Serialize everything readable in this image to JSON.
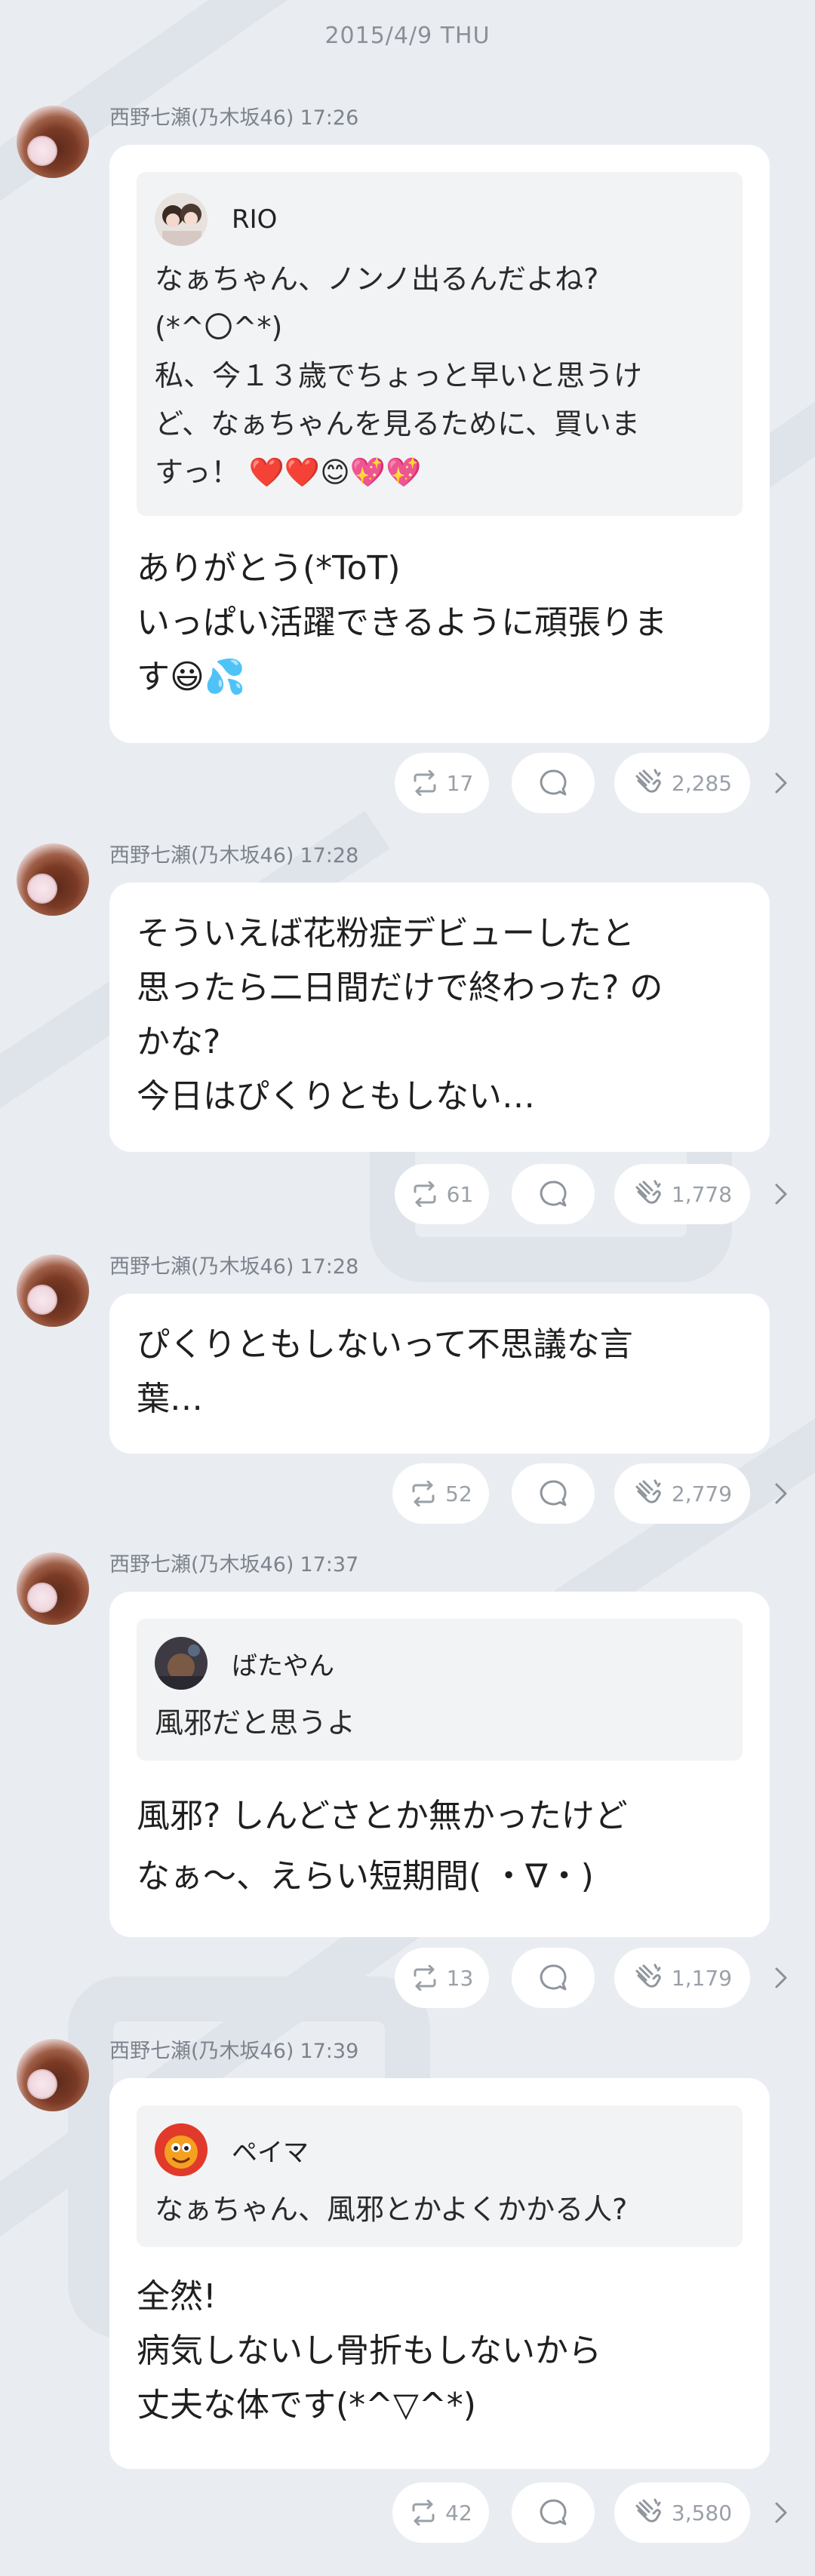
{
  "date_header": "2015/4/9 THU",
  "posts": [
    {
      "author": "西野七瀬(乃木坂46)",
      "time": "17:26",
      "quote": {
        "name": "RIO",
        "lines": [
          "なぁちゃん、ノンノ出るんだよね?",
          "(*^〇^*)",
          "私、今１３歳でちょっと早いと思うけ",
          "ど、なぁちゃんを見るために、買いま",
          "すっ！ ❤️❤️😊💖💖"
        ]
      },
      "lines": [
        "ありがとう(*ToT)",
        "いっぱい活躍できるように頑張りま",
        "す😃💦"
      ],
      "repost": "17",
      "likes": "2,285"
    },
    {
      "author": "西野七瀬(乃木坂46)",
      "time": "17:28",
      "lines": [
        "そういえば花粉症デビューしたと",
        "思ったら二日間だけで終わった? の",
        "かな?",
        "今日はぴくりともしない…"
      ],
      "repost": "61",
      "likes": "1,778"
    },
    {
      "author": "西野七瀬(乃木坂46)",
      "time": "17:28",
      "lines": [
        "ぴくりともしないって不思議な言",
        "葉…"
      ],
      "repost": "52",
      "likes": "2,779"
    },
    {
      "author": "西野七瀬(乃木坂46)",
      "time": "17:37",
      "quote": {
        "name": "ばたやん",
        "lines": [
          "風邪だと思うよ"
        ]
      },
      "lines": [
        "風邪? しんどさとか無かったけど",
        "なぁ～、えらい短期間( ・∇・)"
      ],
      "repost": "13",
      "likes": "1,179"
    },
    {
      "author": "西野七瀬(乃木坂46)",
      "time": "17:39",
      "quote": {
        "name": "ペイマ",
        "lines": [
          "なぁちゃん、風邪とかよくかかる人?"
        ]
      },
      "lines": [
        "全然!",
        "病気しないし骨折もしないから",
        "丈夫な体です(*^▽^*)"
      ],
      "repost": "42",
      "likes": "3,580"
    }
  ]
}
